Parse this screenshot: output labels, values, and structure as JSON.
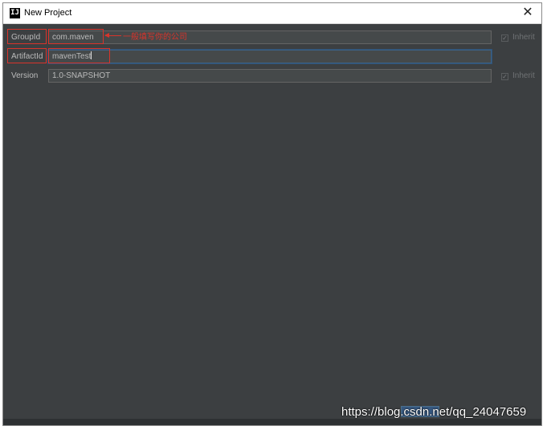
{
  "window": {
    "title": "New Project",
    "close_glyph": "✕",
    "app_icon_text": "IJ"
  },
  "form": {
    "groupid": {
      "label": "GroupId",
      "value": "com.maven",
      "inherit_label": "Inherit",
      "inherit_checked": true
    },
    "artifactid": {
      "label": "ArtifactId",
      "value": "mavenTest"
    },
    "version": {
      "label": "Version",
      "value": "1.0-SNAPSHOT",
      "inherit_label": "Inherit",
      "inherit_checked": true
    }
  },
  "annotation": {
    "text": "一般填写你的公司"
  },
  "watermark": {
    "text": "https://blog.csdn.net/qq_24047659"
  },
  "colors": {
    "background": "#3c3f41",
    "annotation": "#d9342b",
    "focus": "#3d6185"
  }
}
